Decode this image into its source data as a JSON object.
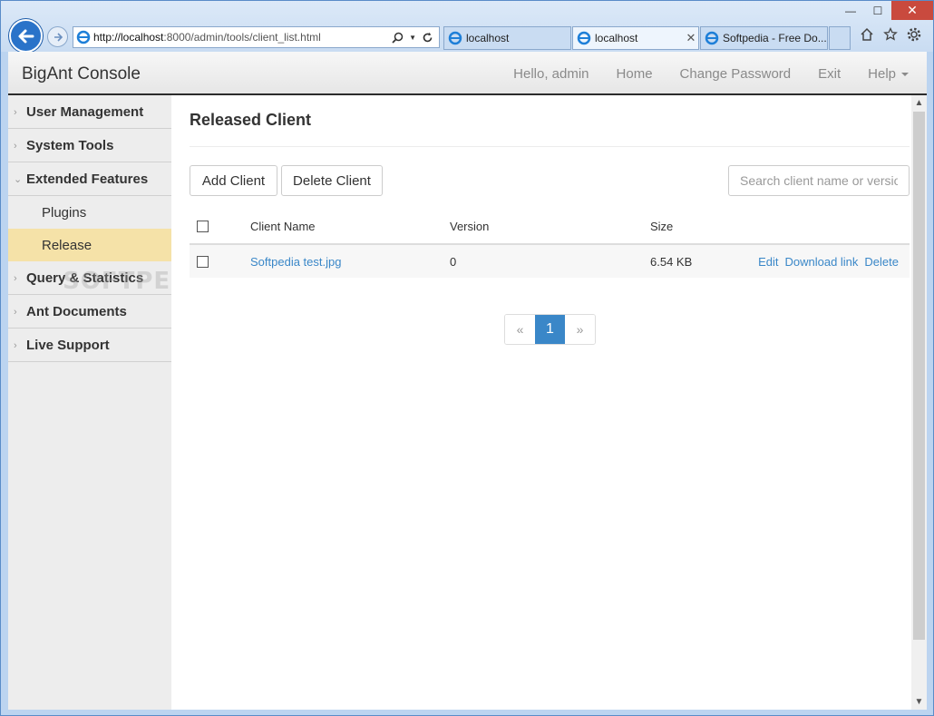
{
  "browser": {
    "url_host": "http://localhost",
    "url_rest": ":8000/admin/tools/client_list.html",
    "tabs": [
      {
        "label": "localhost"
      },
      {
        "label": "localhost"
      },
      {
        "label": "Softpedia - Free Do..."
      }
    ],
    "window_controls": {
      "minimize": "—",
      "maximize": "☐",
      "close": "✕"
    }
  },
  "app": {
    "brand": "BigAnt Console",
    "nav": [
      "Hello, admin",
      "Home",
      "Change Password",
      "Exit",
      "Help"
    ]
  },
  "sidebar": {
    "items": [
      {
        "label": "User Management"
      },
      {
        "label": "System Tools"
      },
      {
        "label": "Extended Features",
        "expanded": true
      },
      {
        "label": "Query & Statistics"
      },
      {
        "label": "Ant Documents"
      },
      {
        "label": "Live Support"
      }
    ],
    "subitems": [
      {
        "label": "Plugins",
        "active": false
      },
      {
        "label": "Release",
        "active": true
      }
    ]
  },
  "main": {
    "title": "Released Client",
    "add_button": "Add Client",
    "delete_button": "Delete Client",
    "search_placeholder": "Search client name or version",
    "columns": [
      "Client Name",
      "Version",
      "Size"
    ],
    "rows": [
      {
        "name": "Softpedia test.jpg",
        "version": "0",
        "size": "6.54 KB",
        "actions": [
          "Edit",
          "Download link",
          "Delete"
        ]
      }
    ],
    "pager": {
      "prev": "«",
      "current": "1",
      "next": "»"
    }
  },
  "watermark": "SOFTPEDIA",
  "colors": {
    "accent": "#3a87c8",
    "active_sidebar": "#f5e2a8"
  }
}
